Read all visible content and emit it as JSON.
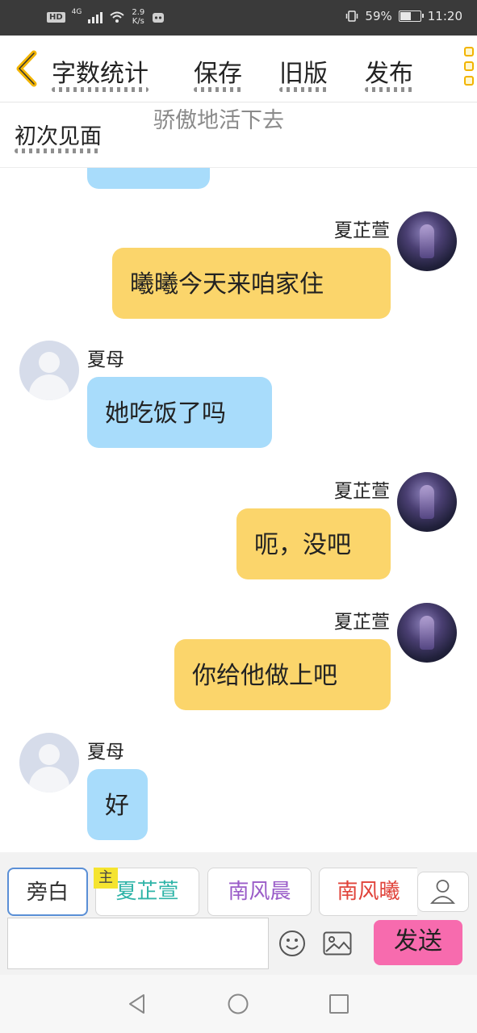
{
  "status_bar": {
    "hd_badge": "HD",
    "network_type": "4G",
    "speed_value": "2.9",
    "speed_unit": "K/s",
    "battery_percent": "59%",
    "battery_level": 0.59,
    "time": "11:20"
  },
  "toolbar": {
    "back_icon": "chevron-left-icon",
    "word_count_label": "字数统计",
    "save_label": "保存",
    "old_version_label": "旧版",
    "publish_label": "发布",
    "more_icon": "more-vertical-icon"
  },
  "chapter": {
    "title": "初次见面",
    "watermark_text": "骄傲地活下去"
  },
  "messages": [
    {
      "side": "right",
      "sender": "夏芷萱",
      "text": "曦曦今天来咱家住"
    },
    {
      "side": "left",
      "sender": "夏母",
      "text": "她吃饭了吗"
    },
    {
      "side": "right",
      "sender": "夏芷萱",
      "text": "呃，没吧"
    },
    {
      "side": "right",
      "sender": "夏芷萱",
      "text": "你给他做上吧"
    },
    {
      "side": "left",
      "sender": "夏母",
      "text": "好"
    }
  ],
  "roles": {
    "narrator": "旁白",
    "main_tag": "主",
    "role_1": "夏芷萱",
    "role_2": "南风晨",
    "role_3": "南风曦"
  },
  "composer": {
    "input_value": "",
    "send_label": "发送",
    "emoji_icon": "smiley-icon",
    "image_icon": "image-icon",
    "person_icon": "person-icon"
  },
  "colors": {
    "left_bubble": "#a8dcfb",
    "right_bubble": "#fbd56b",
    "send_button": "#f76bae",
    "role_1_color": "#2fb4a8",
    "role_2_color": "#9a5cc8",
    "role_3_color": "#e0433a"
  }
}
